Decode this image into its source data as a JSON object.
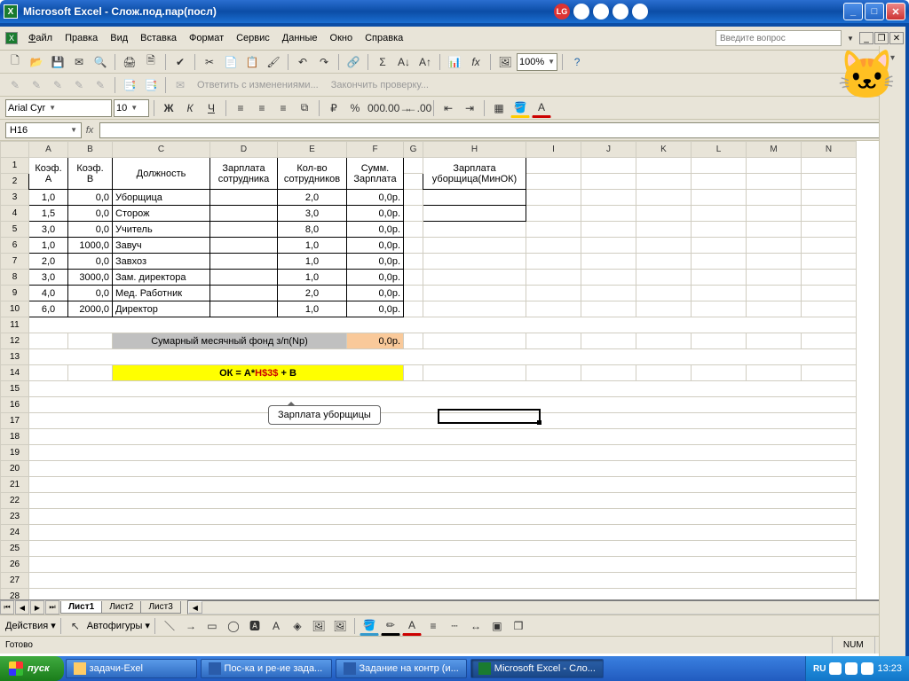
{
  "app": {
    "title": "Microsoft Excel - Слож.под.пар(посл)"
  },
  "menu": {
    "file": "Файл",
    "edit": "Правка",
    "view": "Вид",
    "insert": "Вставка",
    "format": "Формат",
    "tools": "Сервис",
    "data": "Данные",
    "window": "Окно",
    "help": "Справка"
  },
  "helpbox": {
    "placeholder": "Введите вопрос"
  },
  "zoom": {
    "value": "100%"
  },
  "font": {
    "name": "Arial Cyr",
    "size": "10"
  },
  "review": {
    "reply": "Ответить с изменениями...",
    "finish": "Закончить проверку..."
  },
  "namebox": {
    "value": "H16"
  },
  "cols": [
    "A",
    "B",
    "C",
    "D",
    "E",
    "F",
    "G",
    "H",
    "I",
    "J",
    "K",
    "L",
    "M",
    "N"
  ],
  "headers": {
    "A1": "Коэф.",
    "A2": "A",
    "B1": "Коэф.",
    "B2": "B",
    "C": "Должность",
    "D1": "Зарплата",
    "D2": "сотрудника",
    "E1": "Кол-во",
    "E2": "сотрудников",
    "F1": "Сумм.",
    "F2": "Зарплата",
    "H1": "Зарплата",
    "H2": "уборщица(МинОК)"
  },
  "rows": [
    {
      "a": "1,0",
      "b": "0,0",
      "c": "Уборщица",
      "e": "2,0",
      "f": "0,0р."
    },
    {
      "a": "1,5",
      "b": "0,0",
      "c": "Сторож",
      "e": "3,0",
      "f": "0,0р."
    },
    {
      "a": "3,0",
      "b": "0,0",
      "c": "Учитель",
      "e": "8,0",
      "f": "0,0р."
    },
    {
      "a": "1,0",
      "b": "1000,0",
      "c": "Завуч",
      "e": "1,0",
      "f": "0,0р."
    },
    {
      "a": "2,0",
      "b": "0,0",
      "c": "Завхоз",
      "e": "1,0",
      "f": "0,0р."
    },
    {
      "a": "3,0",
      "b": "3000,0",
      "c": "Зам. директора",
      "e": "1,0",
      "f": "0,0р."
    },
    {
      "a": "4,0",
      "b": "0,0",
      "c": "Мед. Работник",
      "e": "2,0",
      "f": "0,0р."
    },
    {
      "a": "6,0",
      "b": "2000,0",
      "c": "Директор",
      "e": "1,0",
      "f": "0,0р."
    }
  ],
  "summary": {
    "label": "Сумарный месячный фонд з/п(Nр)",
    "val": "0,0р."
  },
  "formula": {
    "prefix": "ОК = А*",
    "ref": "H$3$",
    "suffix": " + В"
  },
  "callout": {
    "text": "Зарплата уборщицы"
  },
  "sheets": {
    "s1": "Лист1",
    "s2": "Лист2",
    "s3": "Лист3"
  },
  "drawbar": {
    "actions": "Действия",
    "autoshapes": "Автофигуры"
  },
  "status": {
    "ready": "Готово",
    "num": "NUM"
  },
  "taskbar": {
    "start": "пуск",
    "b1": "задачи-Exel",
    "b2": "Пос-ка и ре-ие зада...",
    "b3": "Задание на контр (и...",
    "b4": "Microsoft Excel - Сло...",
    "lang": "RU",
    "clock": "13:23"
  }
}
